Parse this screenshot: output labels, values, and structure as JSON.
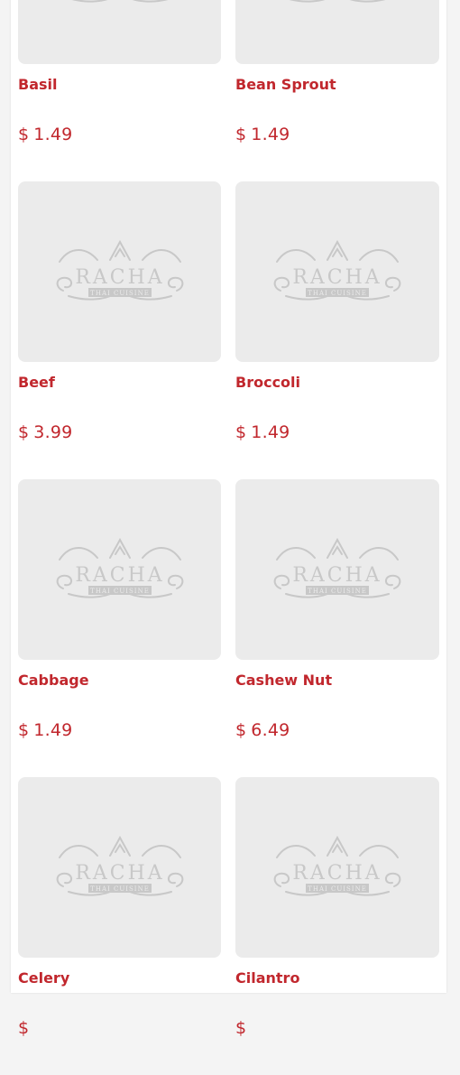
{
  "colors": {
    "accent": "#c1272d",
    "placeholder_bg": "#ebebeb",
    "logo_gray": "#c8c8c8"
  },
  "logo": {
    "brand": "RACHA",
    "tagline": "THAI CUISINE"
  },
  "menu": {
    "items": [
      {
        "name": "Basil",
        "currency": "$",
        "price": "1.49"
      },
      {
        "name": "Bean Sprout",
        "currency": "$",
        "price": "1.49"
      },
      {
        "name": "Beef",
        "currency": "$",
        "price": "3.99"
      },
      {
        "name": "Broccoli",
        "currency": "$",
        "price": "1.49"
      },
      {
        "name": "Cabbage",
        "currency": "$",
        "price": "1.49"
      },
      {
        "name": "Cashew Nut",
        "currency": "$",
        "price": "6.49"
      },
      {
        "name": "Celery",
        "currency": "$",
        "price": ""
      },
      {
        "name": "Cilantro",
        "currency": "$",
        "price": ""
      }
    ]
  }
}
